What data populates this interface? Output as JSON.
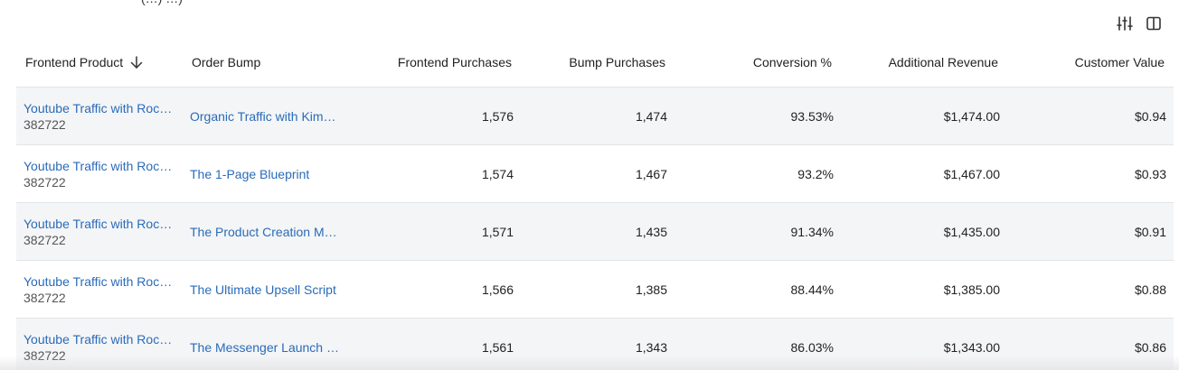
{
  "top_text": "(…) …)",
  "columns": {
    "frontend_product": "Frontend Product",
    "order_bump": "Order Bump",
    "frontend_purchases": "Frontend Purchases",
    "bump_purchases": "Bump Purchases",
    "conversion": "Conversion %",
    "additional_revenue": "Additional Revenue",
    "customer_value": "Customer Value"
  },
  "rows": [
    {
      "product": "Youtube Traffic with Roc…",
      "product_id": "382722",
      "bump": "Organic Traffic with Kim…",
      "frontend_purchases": "1,576",
      "bump_purchases": "1,474",
      "conversion": "93.53%",
      "revenue": "$1,474.00",
      "customer_value": "$0.94"
    },
    {
      "product": "Youtube Traffic with Roc…",
      "product_id": "382722",
      "bump": "The 1-Page Blueprint",
      "frontend_purchases": "1,574",
      "bump_purchases": "1,467",
      "conversion": "93.2%",
      "revenue": "$1,467.00",
      "customer_value": "$0.93"
    },
    {
      "product": "Youtube Traffic with Roc…",
      "product_id": "382722",
      "bump": "The Product Creation M…",
      "frontend_purchases": "1,571",
      "bump_purchases": "1,435",
      "conversion": "91.34%",
      "revenue": "$1,435.00",
      "customer_value": "$0.91"
    },
    {
      "product": "Youtube Traffic with Roc…",
      "product_id": "382722",
      "bump": "The Ultimate Upsell Script",
      "frontend_purchases": "1,566",
      "bump_purchases": "1,385",
      "conversion": "88.44%",
      "revenue": "$1,385.00",
      "customer_value": "$0.88"
    },
    {
      "product": "Youtube Traffic with Roc…",
      "product_id": "382722",
      "bump": "The Messenger Launch …",
      "frontend_purchases": "1,561",
      "bump_purchases": "1,343",
      "conversion": "86.03%",
      "revenue": "$1,343.00",
      "customer_value": "$0.86"
    }
  ],
  "colors": {
    "link": "#2a6bb8",
    "row_alt": "#f4f5f7",
    "border": "#e2e4e8"
  },
  "icons": {
    "filter": "sliders-icon",
    "columns": "columns-icon",
    "sort": "arrow-down-icon"
  }
}
